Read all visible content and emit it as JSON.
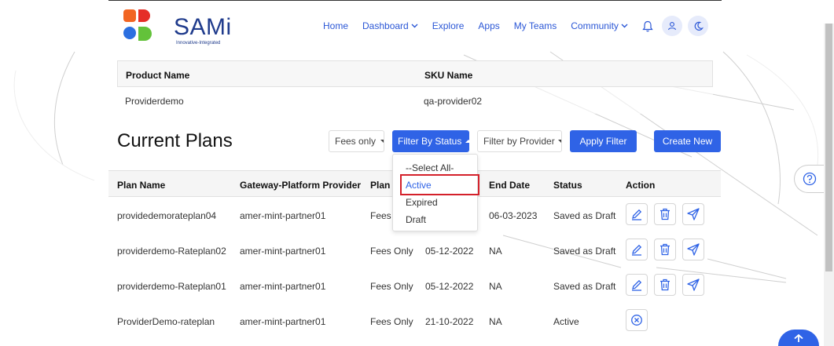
{
  "brand": {
    "name": "SAMi",
    "tagline": "Innovative-Integrated",
    "colors": {
      "orange": "#f26522",
      "red": "#e52d27",
      "blue": "#2b6fe0",
      "green": "#63c23a"
    }
  },
  "nav": {
    "items": [
      {
        "label": "Home",
        "has_dropdown": false
      },
      {
        "label": "Dashboard",
        "has_dropdown": true
      },
      {
        "label": "Explore",
        "has_dropdown": false
      },
      {
        "label": "Apps",
        "has_dropdown": false
      },
      {
        "label": "My Teams",
        "has_dropdown": false
      },
      {
        "label": "Community",
        "has_dropdown": true
      }
    ],
    "icons": [
      "bell-icon",
      "user-icon",
      "moon-icon"
    ]
  },
  "product": {
    "headers": [
      "Product Name",
      "SKU Name"
    ],
    "row": [
      "Providerdemo",
      "qa-provider02"
    ]
  },
  "plans_section": {
    "title": "Current Plans",
    "fees_filter": "Fees only",
    "status_filter": "Filter By Status",
    "provider_filter": "Filter by Provider",
    "apply_label": "Apply Filter",
    "create_label": "Create New"
  },
  "status_dropdown": {
    "options": [
      "--Select All-",
      "Active",
      "Expired",
      "Draft"
    ],
    "highlighted": "Active"
  },
  "plans_table": {
    "headers": [
      "Plan Name",
      "Gateway-Platform Provider",
      "Plan T",
      "",
      "End Date",
      "Status",
      "Action"
    ],
    "rows": [
      {
        "name": "providedemorateplan04",
        "provider": "amer-mint-partner01",
        "plan_type": "Fees O",
        "start": "",
        "end": "06-03-2023",
        "status": "Saved as Draft",
        "actions": [
          "edit-icon",
          "delete-icon",
          "send-icon"
        ]
      },
      {
        "name": "providerdemo-Rateplan02",
        "provider": "amer-mint-partner01",
        "plan_type": "Fees Only",
        "start": "05-12-2022",
        "end": "NA",
        "status": "Saved as Draft",
        "actions": [
          "edit-icon",
          "delete-icon",
          "send-icon"
        ]
      },
      {
        "name": "providerdemo-Rateplan01",
        "provider": "amer-mint-partner01",
        "plan_type": "Fees Only",
        "start": "05-12-2022",
        "end": "NA",
        "status": "Saved as Draft",
        "actions": [
          "edit-icon",
          "delete-icon",
          "send-icon"
        ]
      },
      {
        "name": "ProviderDemo-rateplan",
        "provider": "amer-mint-partner01",
        "plan_type": "Fees Only",
        "start": "21-10-2022",
        "end": "NA",
        "status": "Active",
        "actions": [
          "cancel-icon"
        ]
      }
    ]
  },
  "accent_color": "#2f63e6",
  "highlight_color": "#d4202a"
}
